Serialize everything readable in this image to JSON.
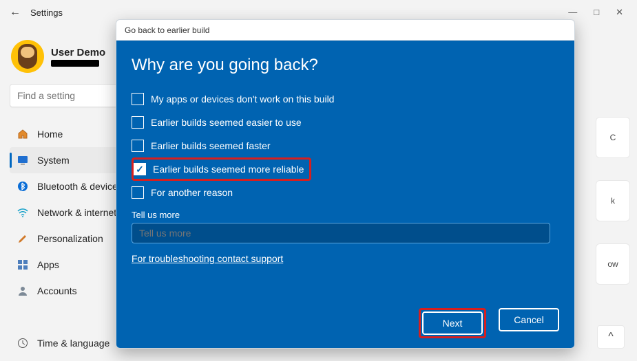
{
  "titlebar": {
    "title": "Settings"
  },
  "user": {
    "name": "User Demo"
  },
  "search": {
    "placeholder": "Find a setting"
  },
  "nav": {
    "home": "Home",
    "system": "System",
    "bluetooth": "Bluetooth & devices",
    "network": "Network & internet",
    "personalization": "Personalization",
    "apps": "Apps",
    "accounts": "Accounts",
    "time": "Time & language"
  },
  "right": {
    "c": "C",
    "k": "k",
    "ow": "ow"
  },
  "dialog": {
    "head": "Go back to earlier build",
    "title": "Why are you going back?",
    "options": {
      "o1": "My apps or devices don't work on this build",
      "o2": "Earlier builds seemed easier to use",
      "o3": "Earlier builds seemed faster",
      "o4": "Earlier builds seemed more reliable",
      "o5": "For another reason"
    },
    "tellmore_label": "Tell us more",
    "tellmore_placeholder": "Tell us more",
    "support_link": "For troubleshooting contact support",
    "next": "Next",
    "cancel": "Cancel"
  }
}
